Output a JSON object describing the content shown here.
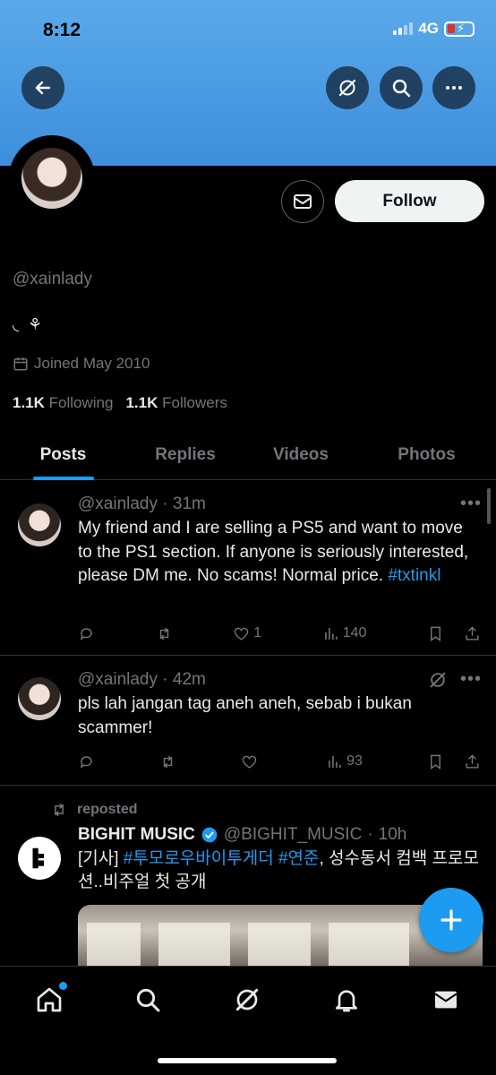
{
  "status_bar": {
    "time": "8:12",
    "network": "4G"
  },
  "profile": {
    "handle": "@xainlady",
    "bio": "◟  ⚘",
    "joined": "Joined May 2010",
    "following_count": "1.1K",
    "following_label": "Following",
    "followers_count": "1.1K",
    "followers_label": "Followers",
    "follow_label": "Follow"
  },
  "tabs": [
    {
      "label": "Posts",
      "active": true
    },
    {
      "label": "Replies",
      "active": false
    },
    {
      "label": "Videos",
      "active": false
    },
    {
      "label": "Photos",
      "active": false
    }
  ],
  "posts": [
    {
      "handle": "@xainlady",
      "time": "31m",
      "text": "My friend and I are selling a PS5 and want to move to the PS1 section. If anyone is seriously interested, please DM me. No scams! Normal price.",
      "hashtag": "#txtinkl",
      "likes": "1",
      "views": "140"
    },
    {
      "handle": "@xainlady",
      "time": "42m",
      "text": "pls lah jangan tag aneh aneh, sebab i bukan scammer!",
      "likes": "",
      "views": "93"
    }
  ],
  "repost": {
    "label": "reposted",
    "name": "BIGHIT MUSIC",
    "handle": "@BIGHIT_MUSIC",
    "time": "10h",
    "text_prefix": "[기사] ",
    "hashtag1": "#투모로우바이투게더",
    "hashtag2": "#연준",
    "text_rest": ", 성수동서 컴백 프로모션..비주얼 첫 공개"
  },
  "colors": {
    "accent": "#1d9bf0",
    "banner": "#4a9be3",
    "background": "#000000",
    "muted": "#71767b"
  }
}
